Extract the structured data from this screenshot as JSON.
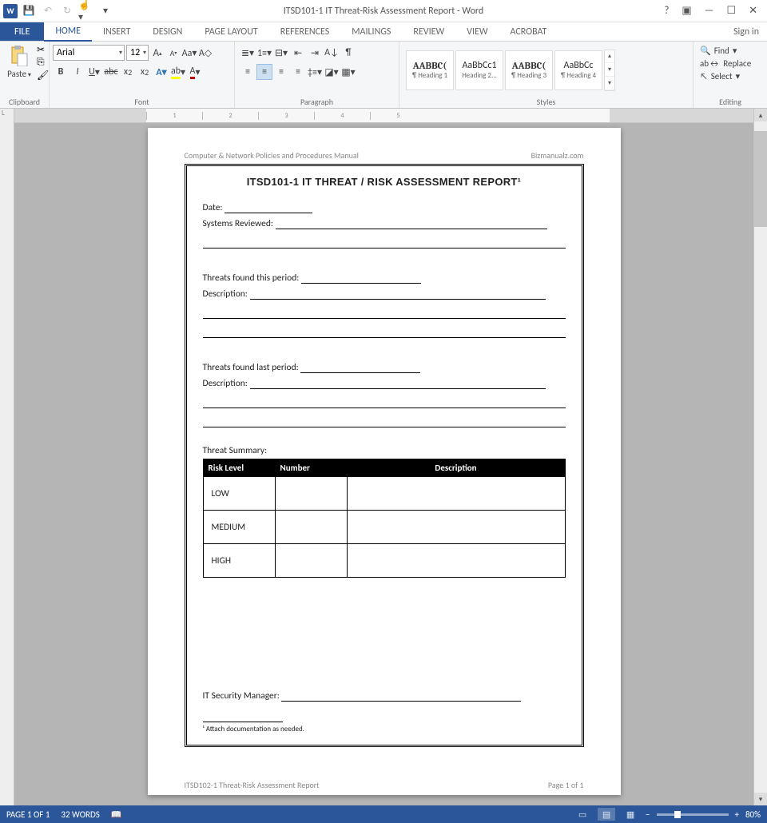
{
  "titlebar": {
    "title": "ITSD101-1 IT Threat-Risk Assessment Report - Word"
  },
  "tabs": {
    "file": "FILE",
    "items": [
      "HOME",
      "INSERT",
      "DESIGN",
      "PAGE LAYOUT",
      "REFERENCES",
      "MAILINGS",
      "REVIEW",
      "VIEW",
      "ACROBAT"
    ],
    "active": 0,
    "signin": "Sign in"
  },
  "ribbon": {
    "clipboard": {
      "title": "Clipboard",
      "paste": "Paste"
    },
    "font": {
      "title": "Font",
      "name": "Arial",
      "size": "12"
    },
    "paragraph": {
      "title": "Paragraph"
    },
    "styles": {
      "title": "Styles",
      "items": [
        {
          "preview": "AABBC(",
          "name": "¶ Heading 1"
        },
        {
          "preview": "AaBbCc1",
          "name": "Heading 2..."
        },
        {
          "preview": "AABBC(",
          "name": "¶ Heading 3"
        },
        {
          "preview": "AaBbCc",
          "name": "¶ Heading 4"
        }
      ]
    },
    "editing": {
      "title": "Editing",
      "find": "Find",
      "replace": "Replace",
      "select": "Select"
    }
  },
  "ruler": {
    "marks": [
      "1",
      "2",
      "3",
      "4",
      "5"
    ]
  },
  "document": {
    "header_left": "Computer & Network Policies and Procedures Manual",
    "header_right": "Bizmanualz.com",
    "title": "ITSD101-1   IT THREAT / RISK ASSESSMENT REPORT¹",
    "fields": {
      "date": "Date:",
      "systems": "Systems Reviewed:",
      "threats_this": "Threats found this period:",
      "description": "Description:",
      "threats_last": "Threats found last period:",
      "summary": "Threat Summary:",
      "manager": "IT Security Manager:"
    },
    "table": {
      "headers": [
        "Risk Level",
        "Number",
        "Description"
      ],
      "rows": [
        "LOW",
        "MEDIUM",
        "HIGH"
      ]
    },
    "footnote": "¹ Attach documentation as needed.",
    "footer_left": "ITSD102-1 Threat-Risk Assessment Report",
    "footer_right": "Page 1 of 1"
  },
  "statusbar": {
    "page": "PAGE 1 OF 1",
    "words": "32 WORDS",
    "zoom": "80%"
  }
}
